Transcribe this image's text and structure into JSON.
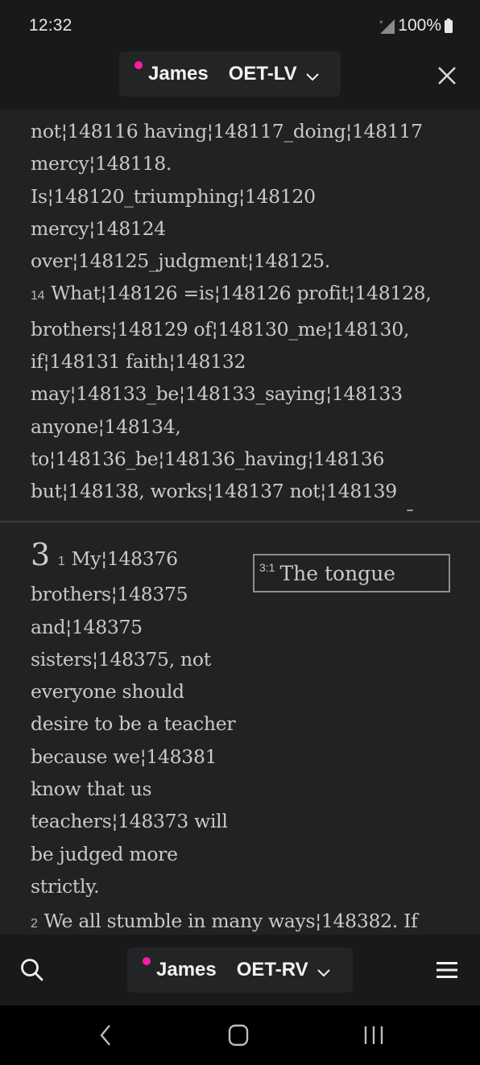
{
  "status_bar": {
    "time": "12:32",
    "battery": "100%",
    "icons": [
      "no-signal-icon",
      "battery-icon"
    ]
  },
  "header": {
    "book": "James",
    "version": "OET-LV",
    "indicator_color": "#ff1aa8",
    "close_icon": "close-icon"
  },
  "top_pane": {
    "lines": [
      {
        "verse": null,
        "text": "not¦148116 having¦148117_doing¦148117"
      },
      {
        "verse": null,
        "text": "mercy¦148118."
      },
      {
        "verse": null,
        "text": "Is¦148120_triumphing¦148120"
      },
      {
        "verse": null,
        "text": "mercy¦148124"
      },
      {
        "verse": null,
        "text": "over¦148125_judgment¦148125."
      },
      {
        "verse": "14",
        "text": "What¦148126 =is¦148126 profit¦148128,"
      },
      {
        "verse": null,
        "text": "brothers¦148129 of¦148130_me¦148130,"
      },
      {
        "verse": null,
        "text": "if¦148131 faith¦148132"
      },
      {
        "verse": null,
        "text": "may¦148133_be¦148133_saying¦148133"
      },
      {
        "verse": null,
        "text": "anyone¦148134,"
      },
      {
        "verse": null,
        "text": "to¦148136_be¦148136_having¦148136"
      },
      {
        "verse": null,
        "text": "but¦148138, works¦148137 not¦148139"
      }
    ]
  },
  "bottom_pane": {
    "chapter": "3",
    "section_heading": {
      "ref": "3:1",
      "text": "The tongue"
    },
    "lines": [
      {
        "verse": "1",
        "text": "My¦148376"
      },
      {
        "verse": null,
        "text": "brothers¦148375"
      },
      {
        "verse": null,
        "text": "and¦148375"
      },
      {
        "verse": null,
        "text": "sisters¦148375, not"
      },
      {
        "verse": null,
        "text": "everyone should"
      },
      {
        "verse": null,
        "text": "desire to be a teacher"
      },
      {
        "verse": null,
        "text": "because we¦148381"
      },
      {
        "verse": null,
        "text": "know that us"
      },
      {
        "verse": null,
        "text": "teachers¦148373 will"
      },
      {
        "verse": null,
        "text": "be judged more"
      },
      {
        "verse": null,
        "text": "strictly."
      },
      {
        "verse": "2",
        "text": "We all stumble in many ways¦148382. If"
      }
    ]
  },
  "bottom_bar": {
    "book": "James",
    "version": "OET-RV",
    "search_icon": "search-icon",
    "menu_icon": "hamburger-menu-icon"
  },
  "nav_bar": {
    "buttons": [
      "back",
      "home",
      "recent-apps"
    ]
  }
}
